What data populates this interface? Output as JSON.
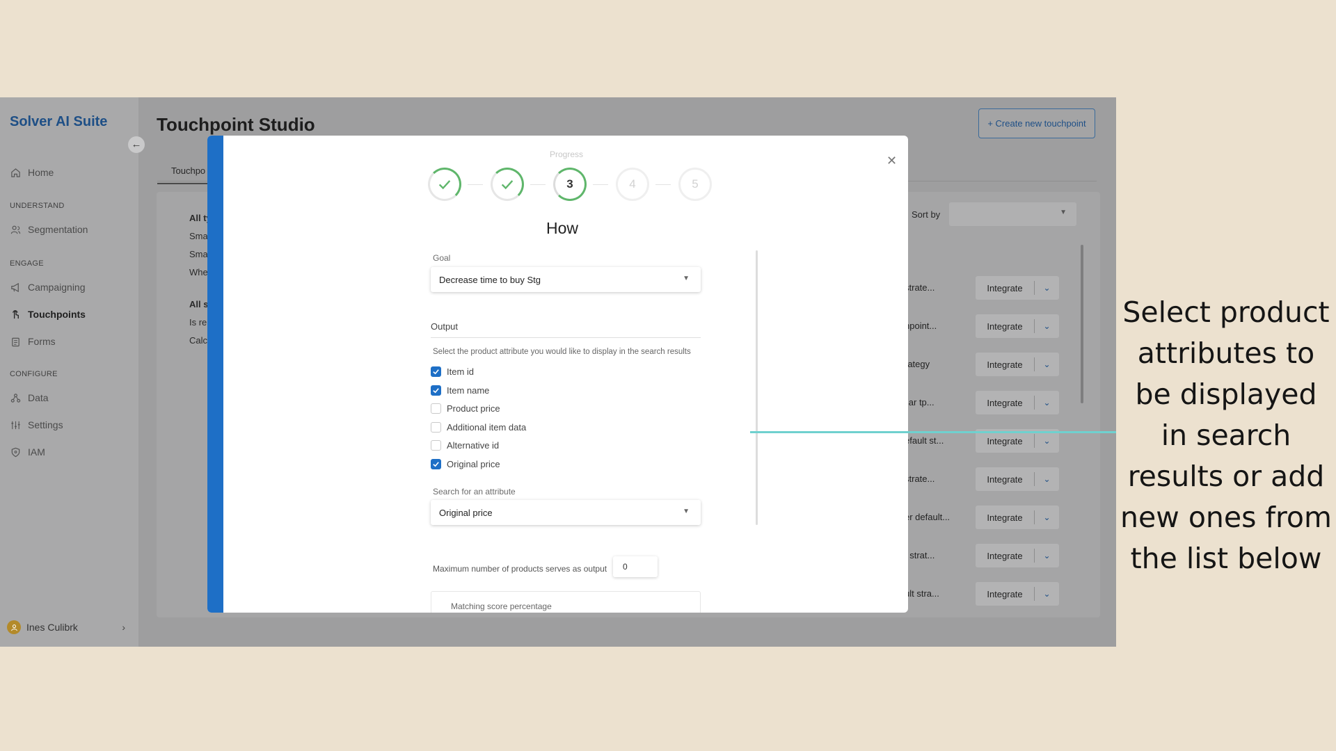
{
  "sidebar": {
    "brand": "Solver AI Suite",
    "collapse_icon": "arrow-left-icon",
    "home": "Home",
    "section_understand": "UNDERSTAND",
    "segmentation": "Segmentation",
    "section_engage": "ENGAGE",
    "campaigning": "Campaigning",
    "touchpoints": "Touchpoints",
    "forms": "Forms",
    "section_configure": "CONFIGURE",
    "data": "Data",
    "settings": "Settings",
    "iam": "IAM",
    "user_name": "Ines Culibrk"
  },
  "header": {
    "title": "Touchpoint Studio",
    "create_button": "+ Create new touchpoint"
  },
  "background": {
    "tab_partial": "Touchpo",
    "filter_lines": [
      "All ty",
      "Sma",
      "Sma",
      "Whe",
      "All s",
      "Is re",
      "Calc"
    ],
    "sort_label": "Sort by",
    "rows": [
      {
        "text": "strate...",
        "action": "Integrate"
      },
      {
        "text": "hpoint...",
        "action": "Integrate"
      },
      {
        "text": "rategy",
        "action": "Integrate"
      },
      {
        "text": "ilar tp...",
        "action": "Integrate"
      },
      {
        "text": "efault st...",
        "action": "Integrate"
      },
      {
        "text": "strate...",
        "action": "Integrate"
      },
      {
        "text": "er default...",
        "action": "Integrate"
      },
      {
        "text": "t strat...",
        "action": "Integrate"
      },
      {
        "text": "ult stra...",
        "action": "Integrate"
      }
    ]
  },
  "modal": {
    "progress_label": "Progress",
    "steps": [
      "",
      "",
      "3",
      "4",
      "5"
    ],
    "heading": "How",
    "goal_label": "Goal",
    "goal_value": "Decrease time to buy Stg",
    "output_title": "Output",
    "output_hint": "Select the product attribute you would like to display in the search results",
    "attributes": [
      {
        "label": "Item id",
        "checked": true
      },
      {
        "label": "Item name",
        "checked": true
      },
      {
        "label": "Product price",
        "checked": false
      },
      {
        "label": "Additional item data",
        "checked": false
      },
      {
        "label": "Alternative id",
        "checked": false
      },
      {
        "label": "Original price",
        "checked": true
      }
    ],
    "search_label": "Search for an attribute",
    "search_value": "Original price",
    "max_label": "Maximum number of products serves as output",
    "max_value": "0",
    "matching_label": "Matching score percentage",
    "close_icon": "close-icon"
  },
  "callout": {
    "text": "Select product attributes to be displayed in search results or add new ones from the list below",
    "line_color": "#6fd1cf"
  },
  "colors": {
    "accent": "#1e6fc6",
    "brand": "#1e4f86",
    "success": "#5fb66b"
  }
}
